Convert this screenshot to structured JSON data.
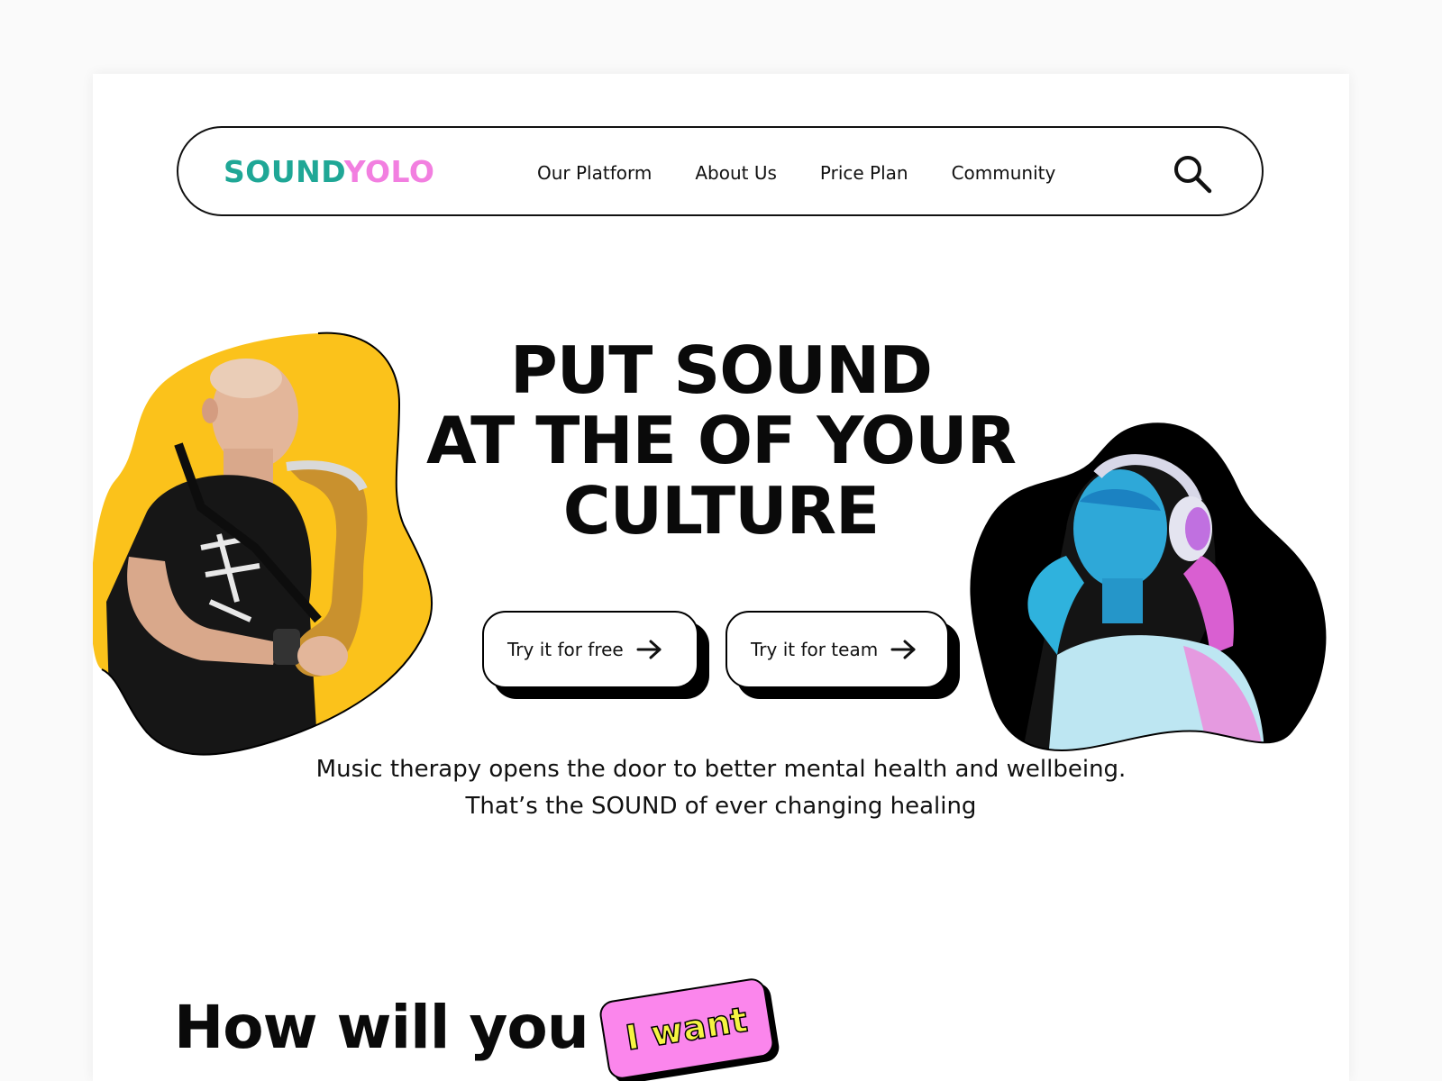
{
  "colors": {
    "brand_teal": "#1fa796",
    "brand_pink": "#f27fe0",
    "sticker_pink": "#fb86ec",
    "sticker_yellow": "#f5f542",
    "blob_left_bg": "#fbc21b",
    "blob_right_bg": "#000000"
  },
  "header": {
    "logo_part1": "SOUND",
    "logo_part2": "YOLO",
    "nav": [
      {
        "label": "Our Platform"
      },
      {
        "label": "About Us"
      },
      {
        "label": "Price Plan"
      },
      {
        "label": "Community"
      }
    ],
    "search_icon": "search-icon"
  },
  "hero": {
    "title_lines": [
      "PUT SOUND",
      "AT THE OF YOUR",
      "CULTURE"
    ],
    "cta_free": "Try it for free",
    "cta_team": "Try it for team",
    "cta_icon": "arrow-right-icon",
    "subtitle_lines": [
      "Music therapy opens the door to better mental health and wellbeing.",
      "That’s the SOUND of ever changing healing"
    ],
    "left_image": "saxophone-player-photo",
    "right_image": "woman-with-headphones-photo"
  },
  "how": {
    "title": "How will you",
    "sticker": "I want"
  }
}
